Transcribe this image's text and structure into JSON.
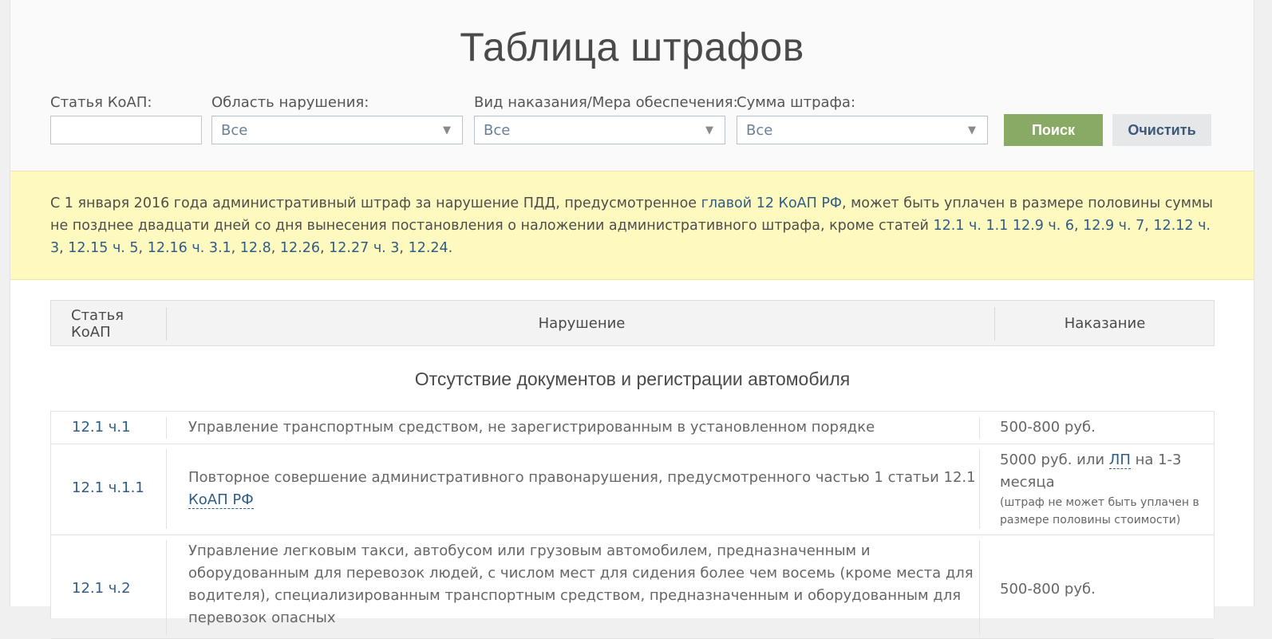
{
  "title": "Таблица штрафов",
  "filters": {
    "article_label": "Статья КоАП:",
    "article_value": "",
    "area_label": "Область нарушения:",
    "area_value": "Все",
    "punishment_label": "Вид наказания/Мера обеспечения:",
    "punishment_value": "Все",
    "amount_label": "Сумма штрафа:",
    "amount_value": "Все",
    "dropdown_arrow": "▼",
    "search_button": "Поиск",
    "clear_button": "Очистить"
  },
  "notice": {
    "text_1": "С 1 января 2016 года административный штраф за нарушение ПДД, предусмотренное ",
    "link_chapter": "главой 12 КоАП РФ",
    "text_2": ", может быть уплачен в размере половины суммы не позднее двадцати дней со дня вынесения постановления о наложении административного штрафа, кроме статей ",
    "articles": [
      "12.1 ч. 1.1",
      "12.9 ч. 6",
      "12.9 ч. 7",
      "12.12 ч. 3",
      "12.15 ч. 5",
      "12.16 ч. 3.1",
      "12.8",
      "12.26",
      "12.27 ч. 3",
      "12.24"
    ],
    "end": "."
  },
  "table": {
    "header": {
      "col_article": "Статья КоАП",
      "col_violation": "Нарушение",
      "col_punishment": "Наказание"
    },
    "section_title": "Отсутствие документов и регистрации автомобиля",
    "rows": [
      {
        "article": "12.1 ч.1",
        "violation": "Управление транспортным средством, не зарегистрированным в установленном порядке",
        "punishment": "500-800 руб."
      },
      {
        "article": "12.1 ч.1.1",
        "violation": "Повторное совершение административного правонарушения, предусмотренного частью 1 статьи 12.1",
        "violation_link": "КоАП РФ",
        "punishment_pre": "5000 руб. или ",
        "punishment_link": "ЛП",
        "punishment_post": " на 1-3 месяца",
        "punishment_note": "(штраф не может быть уплачен в размере половины стоимости)"
      },
      {
        "article": "12.1 ч.2",
        "violation": "Управление легковым такси, автобусом или грузовым автомобилем, предназначенным и оборудованным для перевозок людей, с числом мест для сидения более чем восемь (кроме места для водителя), специализированным транспортным средством, предназначенным и оборудованным для перевозок опасных",
        "punishment": "500-800 руб."
      }
    ]
  },
  "colors": {
    "accent_green": "#89aa64",
    "link_blue": "#2f5d88",
    "notice_yellow": "#fdf9bf"
  }
}
